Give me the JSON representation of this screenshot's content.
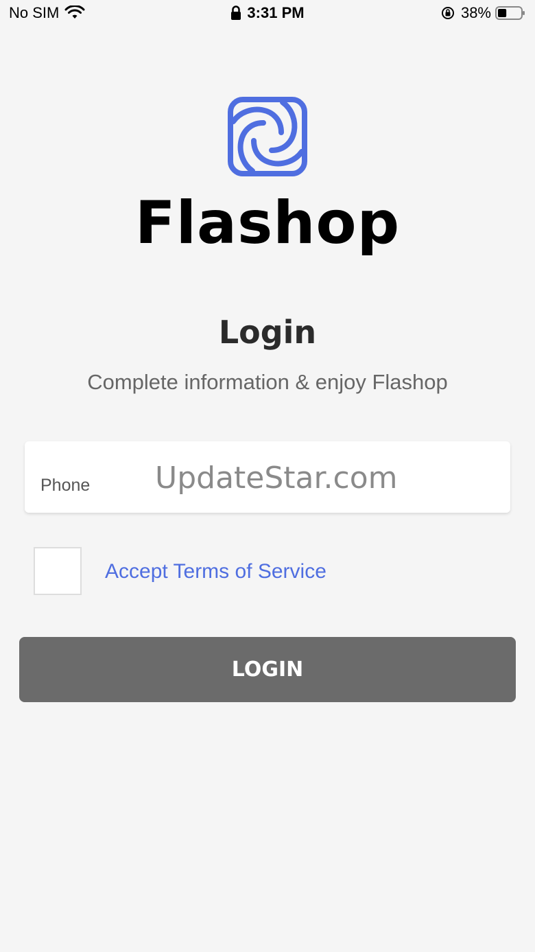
{
  "status_bar": {
    "carrier": "No SIM",
    "time": "3:31 PM",
    "battery_percent": "38%",
    "battery_level": 0.38,
    "icons": [
      "wifi-icon",
      "lock-icon",
      "orientation-lock-icon",
      "battery-icon"
    ]
  },
  "brand": {
    "logo_icon": "flashop-logo-icon",
    "name": "Flashop",
    "accent_color": "#4f6ee0"
  },
  "login": {
    "title": "Login",
    "subtitle": "Complete information & enjoy Flashop"
  },
  "phone_field": {
    "label": "Phone",
    "placeholder": "UpdateStar.com"
  },
  "terms": {
    "checked": false,
    "label": "Accept Terms of Service"
  },
  "login_button": {
    "label": "LOGIN",
    "color": "#6b6b6b"
  }
}
